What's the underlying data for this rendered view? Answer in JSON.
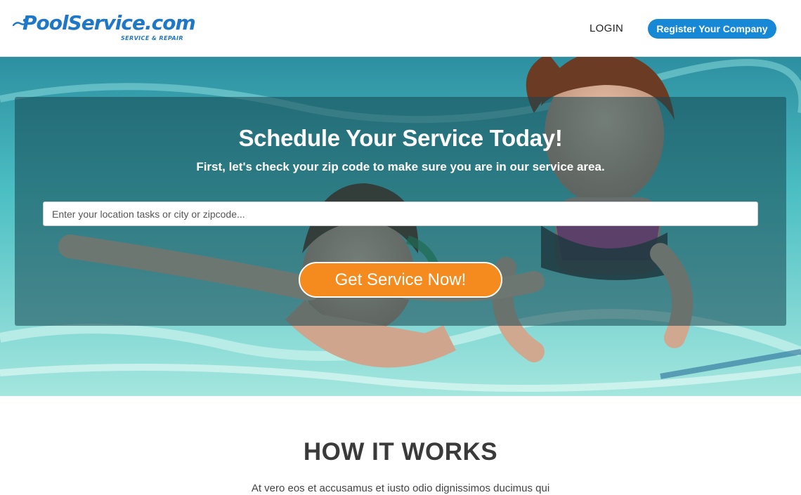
{
  "brand": {
    "logo_text": "PoolService.com",
    "tagline": "SERVICE & REPAIR",
    "brand_color": "#1f77c8"
  },
  "nav": {
    "login_label": "LOGIN",
    "register_label": "Register Your Company",
    "register_color": "#1688d6"
  },
  "hero": {
    "title": "Schedule Your Service Today!",
    "subtitle": "First, let's check your zip code to make sure you are in our service area.",
    "search": {
      "placeholder": "Enter your location tasks or city or zipcode...",
      "value": ""
    },
    "cta_label": "Get Service Now!",
    "cta_color": "#f58a1f",
    "background_image": "kids-swimming-underwater-photo"
  },
  "how_it_works": {
    "title": "HOW IT WORKS",
    "text": "At vero eos et accusamus et iusto odio dignissimos ducimus qui"
  }
}
